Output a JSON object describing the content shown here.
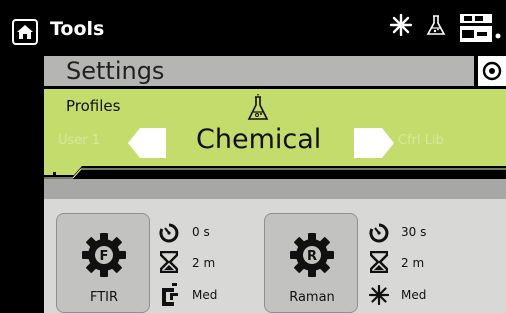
{
  "header": {
    "title": "Tools",
    "icons": [
      "home-icon",
      "laser-icon",
      "flask-icon",
      "battery-icon"
    ]
  },
  "settings": {
    "title": "Settings",
    "side_icon": "eye-icon"
  },
  "profiles": {
    "label": "Profiles",
    "current": "Chemical",
    "prev": "User 1",
    "next": "Cfrl Lib",
    "icon": "flask-icon"
  },
  "tiles": [
    {
      "name": "FTIR",
      "letter": "F",
      "stats": [
        {
          "icon": "timer-icon",
          "value": "0 s"
        },
        {
          "icon": "hourglass-icon",
          "value": "2 m"
        },
        {
          "icon": "ftir-power-icon",
          "value": "Med"
        }
      ]
    },
    {
      "name": "Raman",
      "letter": "R",
      "stats": [
        {
          "icon": "timer-icon",
          "value": "30 s"
        },
        {
          "icon": "hourglass-icon",
          "value": "2 m"
        },
        {
          "icon": "laser-power-icon",
          "value": "Med"
        }
      ]
    }
  ],
  "colors": {
    "accent_green": "#c3dc6b",
    "bar_grey": "#b5b6b4"
  }
}
